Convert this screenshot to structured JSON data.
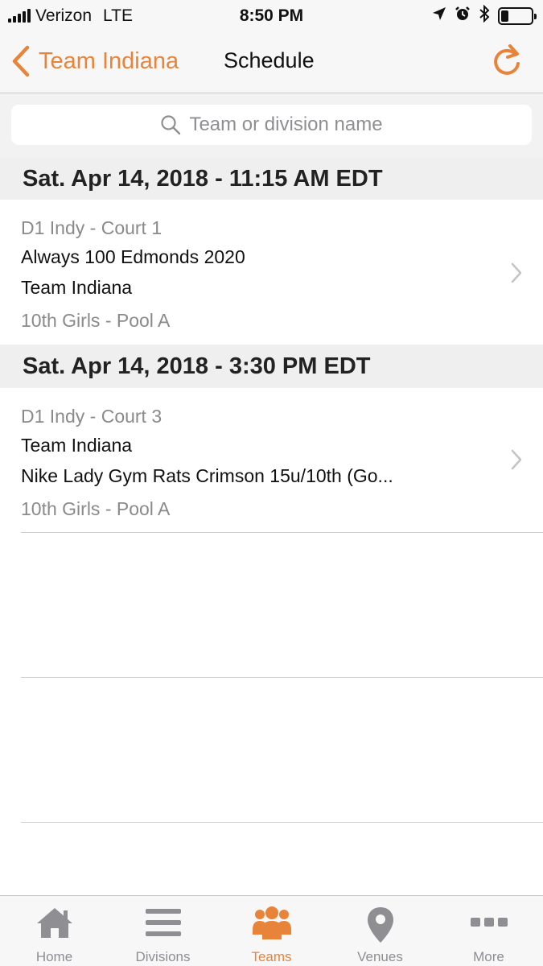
{
  "status_bar": {
    "carrier": "Verizon",
    "network": "LTE",
    "time": "8:50 PM",
    "battery_level": 0.25
  },
  "nav": {
    "back_label": "Team Indiana",
    "title": "Schedule"
  },
  "search": {
    "placeholder": "Team or division name"
  },
  "sections": [
    {
      "header": "Sat. Apr 14, 2018 - 11:15 AM EDT",
      "game": {
        "venue": "D1 Indy - Court 1",
        "team1": "Always 100 Edmonds 2020",
        "team2": "Team Indiana",
        "division": "10th Girls - Pool A"
      }
    },
    {
      "header": "Sat. Apr 14, 2018 - 3:30 PM EDT",
      "game": {
        "venue": "D1 Indy - Court 3",
        "team1": "Team Indiana",
        "team2": "Nike Lady Gym Rats Crimson 15u/10th (Go...",
        "division": "10th Girls - Pool A"
      }
    }
  ],
  "tabs": [
    {
      "label": "Home",
      "icon": "home-icon",
      "active": false
    },
    {
      "label": "Divisions",
      "icon": "list-icon",
      "active": false
    },
    {
      "label": "Teams",
      "icon": "people-icon",
      "active": true
    },
    {
      "label": "Venues",
      "icon": "map-pin-icon",
      "active": false
    },
    {
      "label": "More",
      "icon": "more-dots-icon",
      "active": false
    }
  ],
  "colors": {
    "accent": "#e8843a",
    "inactive": "#8e8e93"
  }
}
